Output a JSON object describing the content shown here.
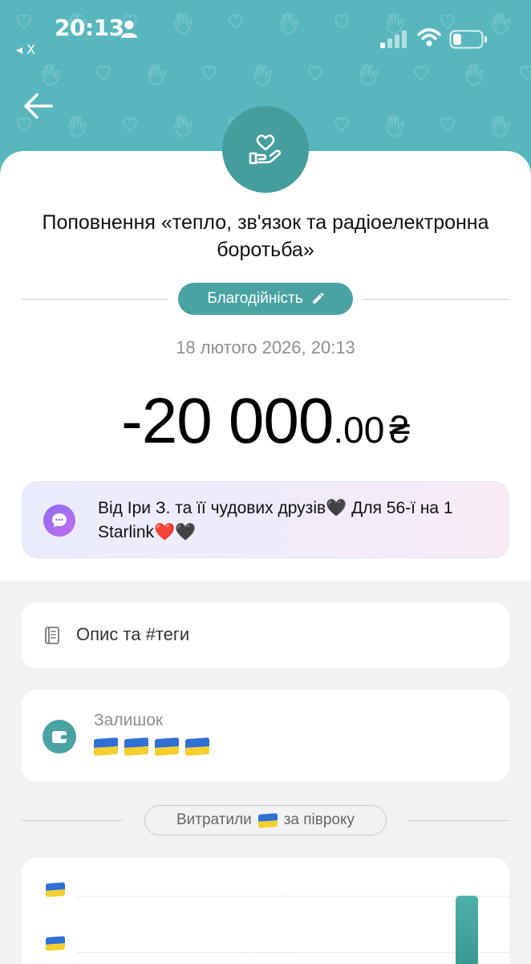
{
  "status_bar": {
    "time": "20:13",
    "back_app": "◂ X",
    "icons": [
      "person-icon",
      "signal-icon",
      "wifi-icon",
      "battery-icon"
    ]
  },
  "nav": {
    "back_icon": "arrow-left-icon"
  },
  "transaction": {
    "category_icon": "heart-hand-icon",
    "title": "Поповнення «тепло, зв'язок та радіоелектронна боротьба»",
    "category": "Благодійність",
    "category_edit_icon": "pencil-icon",
    "date": "18 лютого 2026, 20:13",
    "amount_main": "-20 000",
    "amount_cents": ".00",
    "currency": "₴",
    "comment": "Від Іри З. та її чудових друзів🖤 Для 56-ї на 1 Starlink❤️🖤"
  },
  "description": {
    "label": "Опис та #теги",
    "icon": "notes-icon"
  },
  "balance": {
    "label": "Залишок",
    "icon": "wallet-icon",
    "value_flags_count": 4
  },
  "spent": {
    "label_before": "Витратили",
    "label_after": "за півроку",
    "flag_icon": "ukraine-flag-icon"
  },
  "chart_data": {
    "type": "bar",
    "y_tick_labels": [
      "🇺🇦",
      "🇺🇦"
    ],
    "series": [
      {
        "values_visible_fraction": [
          0,
          0,
          0,
          0,
          0,
          1
        ]
      }
    ]
  },
  "colors": {
    "header_bg": "#58b7bd",
    "accent": "#4aa3a3",
    "category_icon_bg": "#459d9c",
    "page_bg": "#f2f2f4"
  }
}
